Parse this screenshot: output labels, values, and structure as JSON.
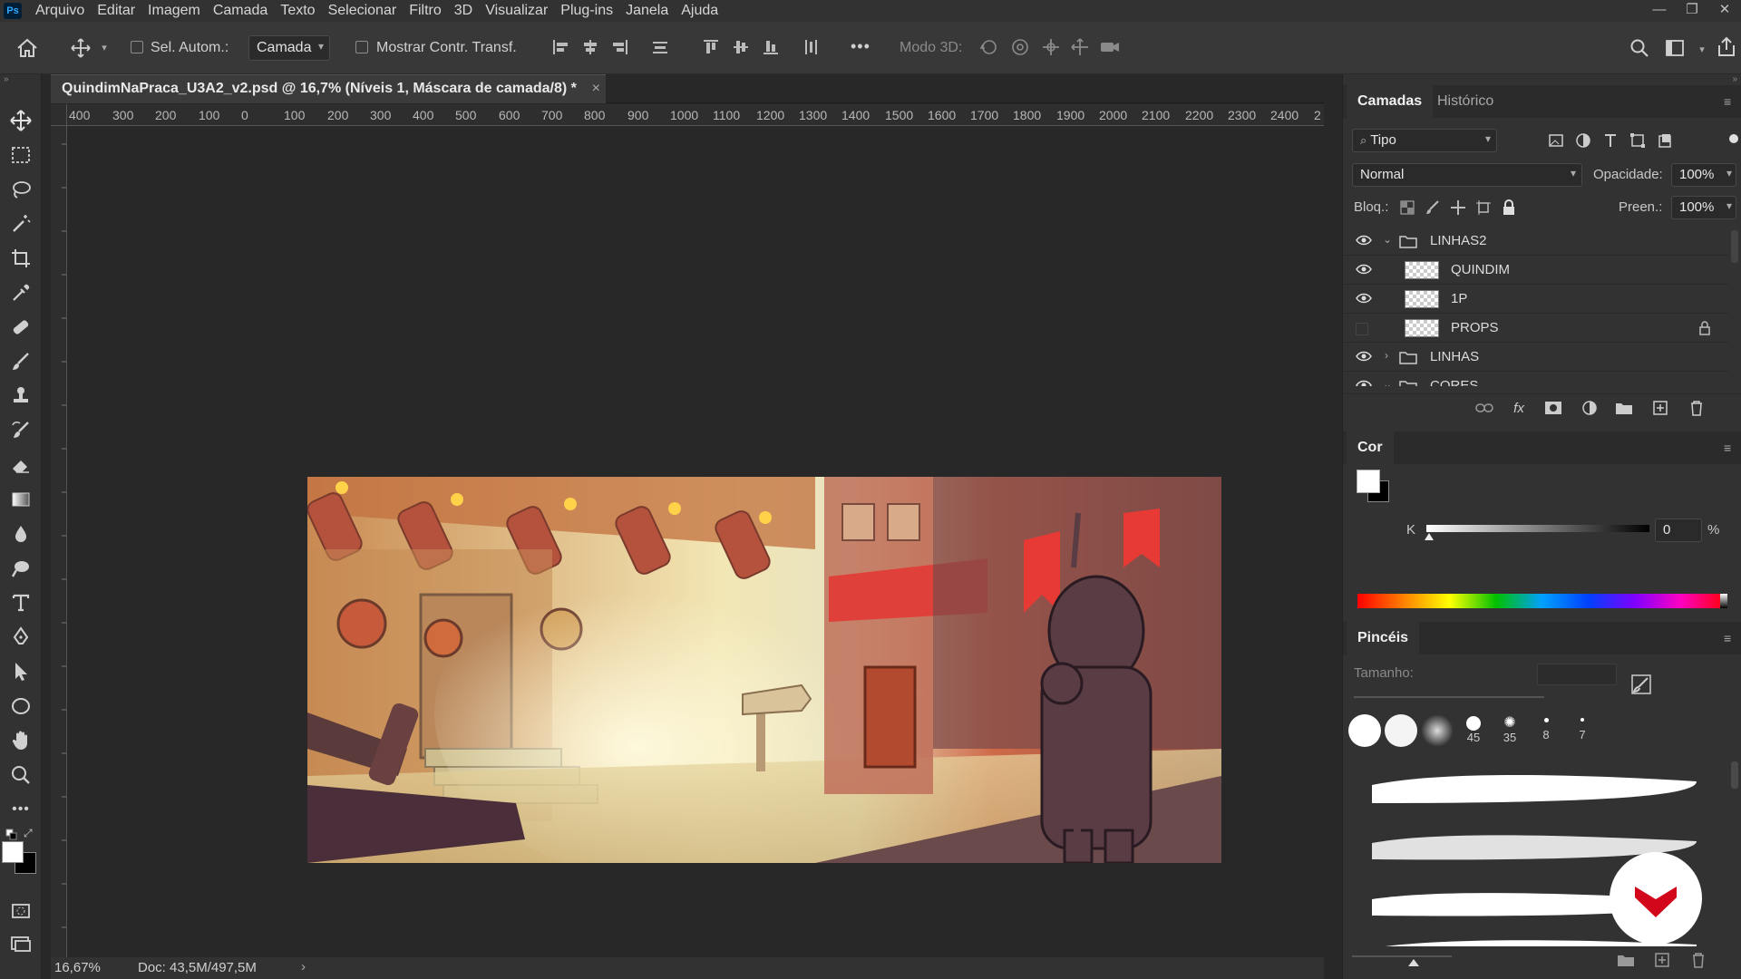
{
  "app": {
    "logo": "Ps"
  },
  "menu": [
    "Arquivo",
    "Editar",
    "Imagem",
    "Camada",
    "Texto",
    "Selecionar",
    "Filtro",
    "3D",
    "Visualizar",
    "Plug-ins",
    "Janela",
    "Ajuda"
  ],
  "window_controls": {
    "minimize": "—",
    "restore": "❐",
    "close": "✕"
  },
  "options": {
    "auto_select_label": "Sel. Autom.:",
    "auto_select_target": "Camada",
    "show_transform_label": "Mostrar Contr. Transf.",
    "mode3d_label": "Modo 3D:",
    "more": "•••"
  },
  "document": {
    "tab_title": "QuindimNaPraca_U3A2_v2.psd @ 16,7% (Níveis 1, Máscara de camada/8) *",
    "close": "×"
  },
  "ruler_top": [
    "400",
    "300",
    "200",
    "100",
    "0",
    "100",
    "200",
    "300",
    "400",
    "500",
    "600",
    "700",
    "800",
    "900",
    "1000",
    "1100",
    "1200",
    "1300",
    "1400",
    "1500",
    "1600",
    "1700",
    "1800",
    "1900",
    "2000",
    "2100",
    "2200",
    "2300",
    "2400",
    "2"
  ],
  "status": {
    "zoom": "16,67%",
    "doc": "Doc: 43,5M/497,5M",
    "arrow": "›"
  },
  "layers_panel": {
    "tabs": [
      "Camadas",
      "Histórico"
    ],
    "filter_label": "Tipo",
    "blend_mode": "Normal",
    "opacity_label": "Opacidade:",
    "opacity_value": "100%",
    "lock_label": "Bloq.:",
    "fill_label": "Preen.:",
    "fill_value": "100%",
    "layers": [
      {
        "name": "LINHAS2",
        "type": "group",
        "visible": true,
        "expanded": true,
        "indent": 0
      },
      {
        "name": "QUINDIM",
        "type": "layer",
        "visible": true,
        "indent": 1
      },
      {
        "name": "1P",
        "type": "layer",
        "visible": true,
        "indent": 1
      },
      {
        "name": "PROPS",
        "type": "layer",
        "visible": false,
        "locked": true,
        "indent": 1
      },
      {
        "name": "LINHAS",
        "type": "group",
        "visible": true,
        "expanded": false,
        "indent": 0
      },
      {
        "name": "CORES",
        "type": "group",
        "visible": true,
        "expanded": true,
        "indent": 0
      }
    ]
  },
  "color_panel": {
    "title": "Cor",
    "channel_label": "K",
    "channel_value": "0",
    "percent": "%"
  },
  "brushes_panel": {
    "title": "Pincéis",
    "size_label": "Tamanho:",
    "presets": [
      {
        "label": ""
      },
      {
        "label": ""
      },
      {
        "label": ""
      },
      {
        "label": "45"
      },
      {
        "label": "35"
      },
      {
        "label": "8"
      },
      {
        "label": "7"
      }
    ]
  },
  "colors": {
    "accent_red": "#d3071b",
    "foreground": "#ffffff",
    "background": "#000000"
  }
}
